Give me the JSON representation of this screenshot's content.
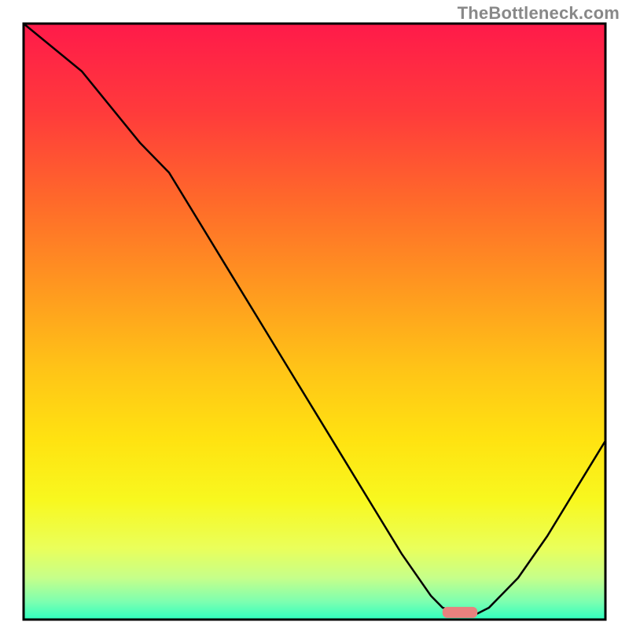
{
  "watermark": "TheBottleneck.com",
  "chart_data": {
    "type": "line",
    "title": "",
    "xlabel": "",
    "ylabel": "",
    "xlim": [
      0,
      100
    ],
    "ylim": [
      0,
      100
    ],
    "series": [
      {
        "name": "curve",
        "x": [
          0,
          10,
          20,
          25,
          30,
          35,
          40,
          45,
          50,
          55,
          60,
          65,
          70,
          72,
          75,
          78,
          80,
          85,
          90,
          95,
          100
        ],
        "y": [
          100,
          92,
          80,
          75,
          67,
          59,
          51,
          43,
          35,
          27,
          19,
          11,
          4,
          2,
          1,
          1,
          2,
          7,
          14,
          22,
          30
        ]
      }
    ],
    "marker": {
      "x_start": 72,
      "x_end": 78,
      "y": 1.2
    },
    "gradient_stops": [
      {
        "offset": 0.0,
        "color": "#ff1a4a"
      },
      {
        "offset": 0.15,
        "color": "#ff3b3b"
      },
      {
        "offset": 0.3,
        "color": "#ff6a2a"
      },
      {
        "offset": 0.45,
        "color": "#ff9a1f"
      },
      {
        "offset": 0.58,
        "color": "#ffc417"
      },
      {
        "offset": 0.7,
        "color": "#ffe311"
      },
      {
        "offset": 0.8,
        "color": "#f8f81f"
      },
      {
        "offset": 0.88,
        "color": "#eaff5a"
      },
      {
        "offset": 0.93,
        "color": "#c6ff8a"
      },
      {
        "offset": 0.97,
        "color": "#7dffb0"
      },
      {
        "offset": 1.0,
        "color": "#2effc0"
      }
    ],
    "frame_color": "#000000",
    "marker_color": "#e8817e"
  }
}
